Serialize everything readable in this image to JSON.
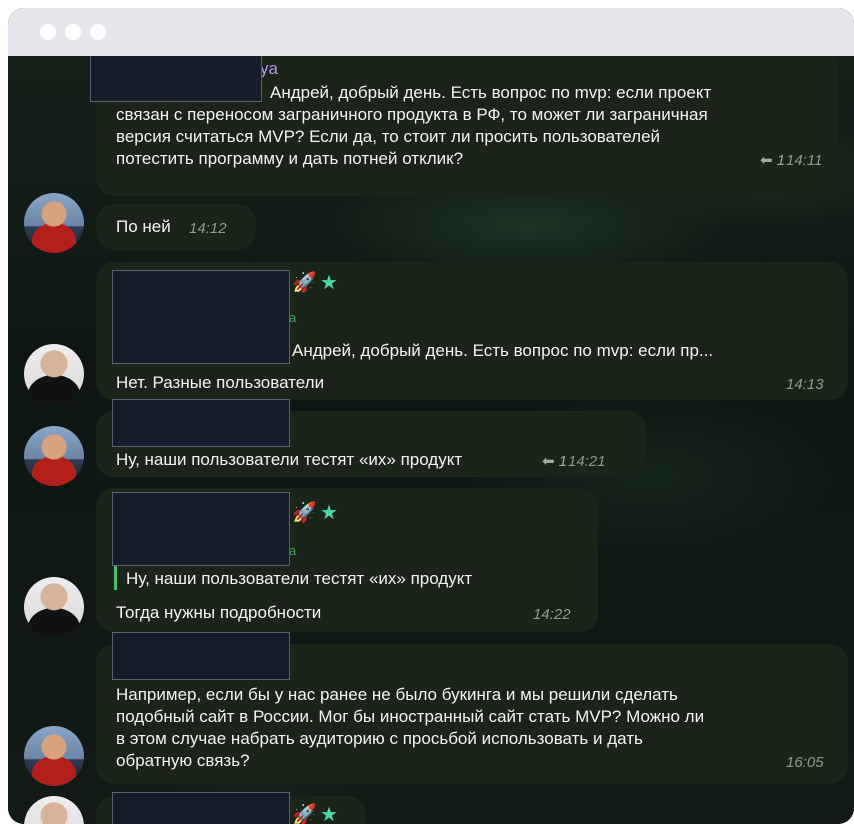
{
  "window": {
    "traffic_lights": [
      "close-dot",
      "minimize-dot",
      "zoom-dot"
    ]
  },
  "messages": {
    "m1": {
      "sender_fragment": "ya",
      "lines": [
        "Андрей, добрый день. Есть вопрос по mvp: если проект",
        "связан с переносом заграничного продукта в РФ, то может ли заграничная",
        "версия считаться MVP? Если да, то стоит ли просить пользователей",
        "потестить программу и дать потней отклик?"
      ],
      "reply_count": "1",
      "time": "14:11"
    },
    "m2": {
      "text": "По ней",
      "time": "14:12"
    },
    "m3": {
      "emoji_rocket": "🚀",
      "emoji_star": "★",
      "green_a": "a",
      "quote": "Андрей, добрый день. Есть вопрос по mvp: если пр...",
      "text": "Нет. Разные пользователи",
      "time": "14:13"
    },
    "m4": {
      "text": "Ну, наши пользователи тестят «их» продукт",
      "reply_count": "1",
      "time": "14:21"
    },
    "m5": {
      "emoji_rocket": "🚀",
      "emoji_star": "★",
      "green_a": "a",
      "quote": "Ну, наши пользователи тестят «их» продукт",
      "text": "Тогда нужны подробности",
      "time": "14:22"
    },
    "m6": {
      "lines": [
        "Например, если бы у нас ранее не было букинга и мы решили сделать",
        "подобный сайт в России. Мог бы иностранный сайт стать MVP? Можно ли",
        "в этом случае набрать аудиторию с просьбой использовать и дать",
        "обратную связь?"
      ],
      "time": "16:05"
    },
    "m7": {
      "emoji_rocket": "🚀",
      "emoji_star": "★"
    }
  }
}
